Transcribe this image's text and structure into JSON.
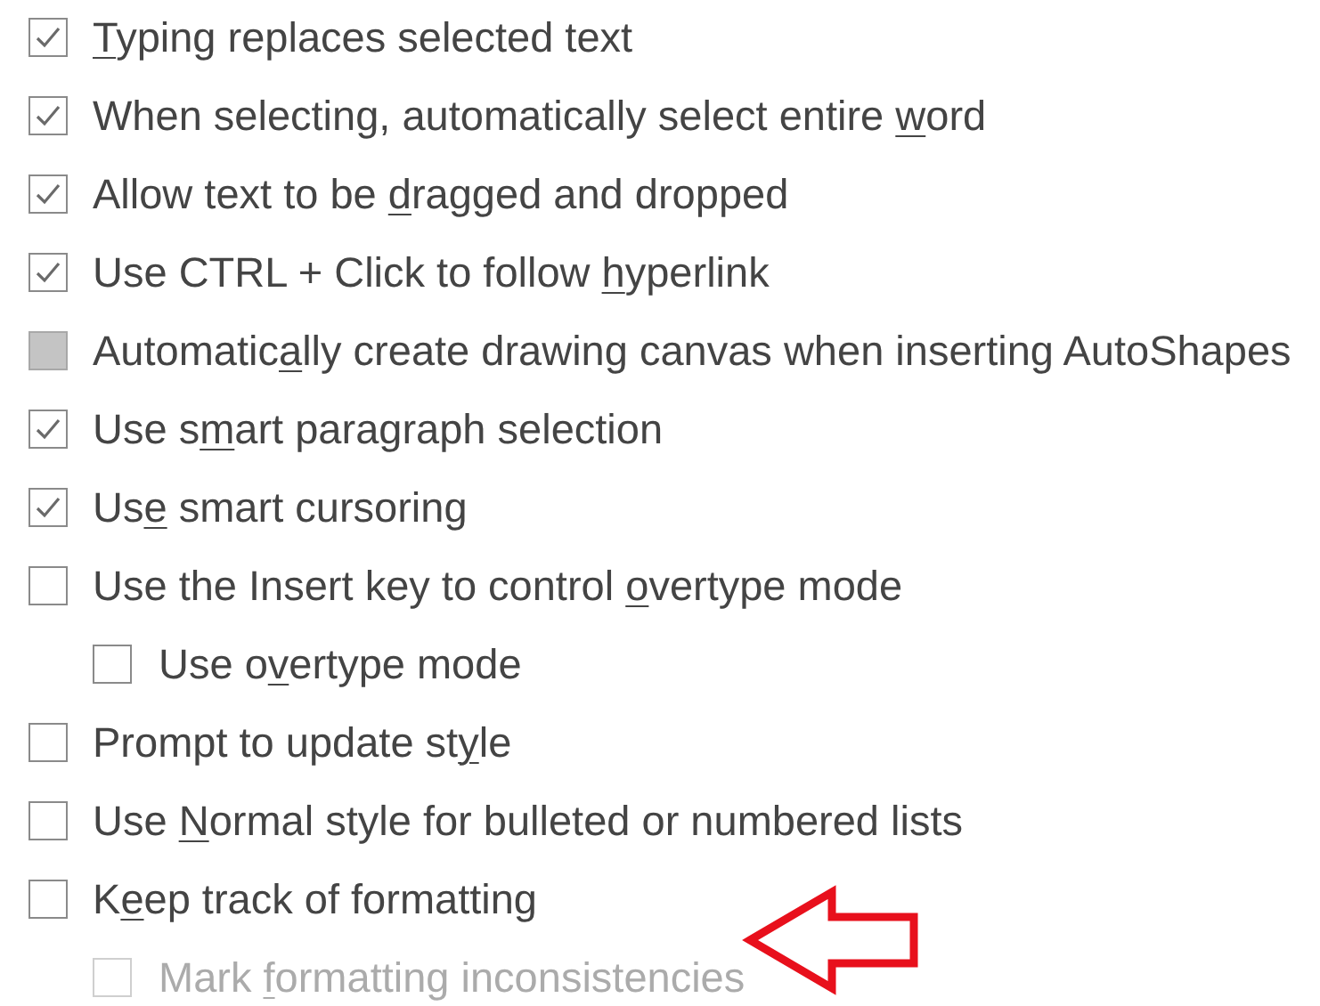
{
  "items": [
    {
      "kind": "checkbox",
      "access_key": "T",
      "text_after": "yping replaces selected text",
      "checked": true,
      "indeterminate": false,
      "disabled": false
    },
    {
      "kind": "checkbox",
      "text_before": "When selecting, automatically select entire ",
      "access_key": "w",
      "text_after": "ord",
      "checked": true,
      "indeterminate": false,
      "disabled": false
    },
    {
      "kind": "checkbox",
      "text_before": "Allow text to be ",
      "access_key": "d",
      "text_after": "ragged and dropped",
      "checked": true,
      "indeterminate": false,
      "disabled": false
    },
    {
      "kind": "checkbox",
      "text_before": "Use CTRL + Click to follow ",
      "access_key": "h",
      "text_after": "yperlink",
      "checked": true,
      "indeterminate": false,
      "disabled": false
    },
    {
      "kind": "checkbox",
      "text_before": "Automatic",
      "access_key": "a",
      "text_after": "lly create drawing canvas when inserting AutoShapes",
      "checked": false,
      "indeterminate": true,
      "disabled": false
    },
    {
      "kind": "checkbox",
      "text_before": "Use s",
      "access_key": "m",
      "text_after": "art paragraph selection",
      "checked": true,
      "indeterminate": false,
      "disabled": false
    },
    {
      "kind": "checkbox",
      "text_before": "Us",
      "access_key": "e",
      "text_after": " smart cursoring",
      "checked": true,
      "indeterminate": false,
      "disabled": false
    },
    {
      "kind": "checkbox",
      "text_before": "Use the Insert key to control ",
      "access_key": "o",
      "text_after": "vertype mode",
      "checked": false,
      "indeterminate": false,
      "disabled": false,
      "children": [
        {
          "kind": "checkbox",
          "text_before": "Use o",
          "access_key": "v",
          "text_after": "ertype mode",
          "checked": false,
          "indeterminate": false,
          "disabled": false
        }
      ]
    },
    {
      "kind": "checkbox",
      "text_before": "Prompt to update st",
      "access_key": "y",
      "text_after": "le",
      "checked": false,
      "indeterminate": false,
      "disabled": false
    },
    {
      "kind": "checkbox",
      "text_before": "Use ",
      "access_key": "N",
      "text_after": "ormal style for bulleted or numbered lists",
      "checked": false,
      "indeterminate": false,
      "disabled": false
    },
    {
      "kind": "checkbox",
      "text_before": "K",
      "access_key": "e",
      "text_after": "ep track of formatting",
      "checked": false,
      "indeterminate": false,
      "disabled": false,
      "children": [
        {
          "kind": "checkbox",
          "text_before": "Mark ",
          "access_key": "f",
          "text_after": "ormatting inconsistencies",
          "checked": false,
          "indeterminate": false,
          "disabled": true
        }
      ]
    }
  ],
  "annotation": {
    "kind": "left-arrow",
    "color": "#e8101c"
  }
}
